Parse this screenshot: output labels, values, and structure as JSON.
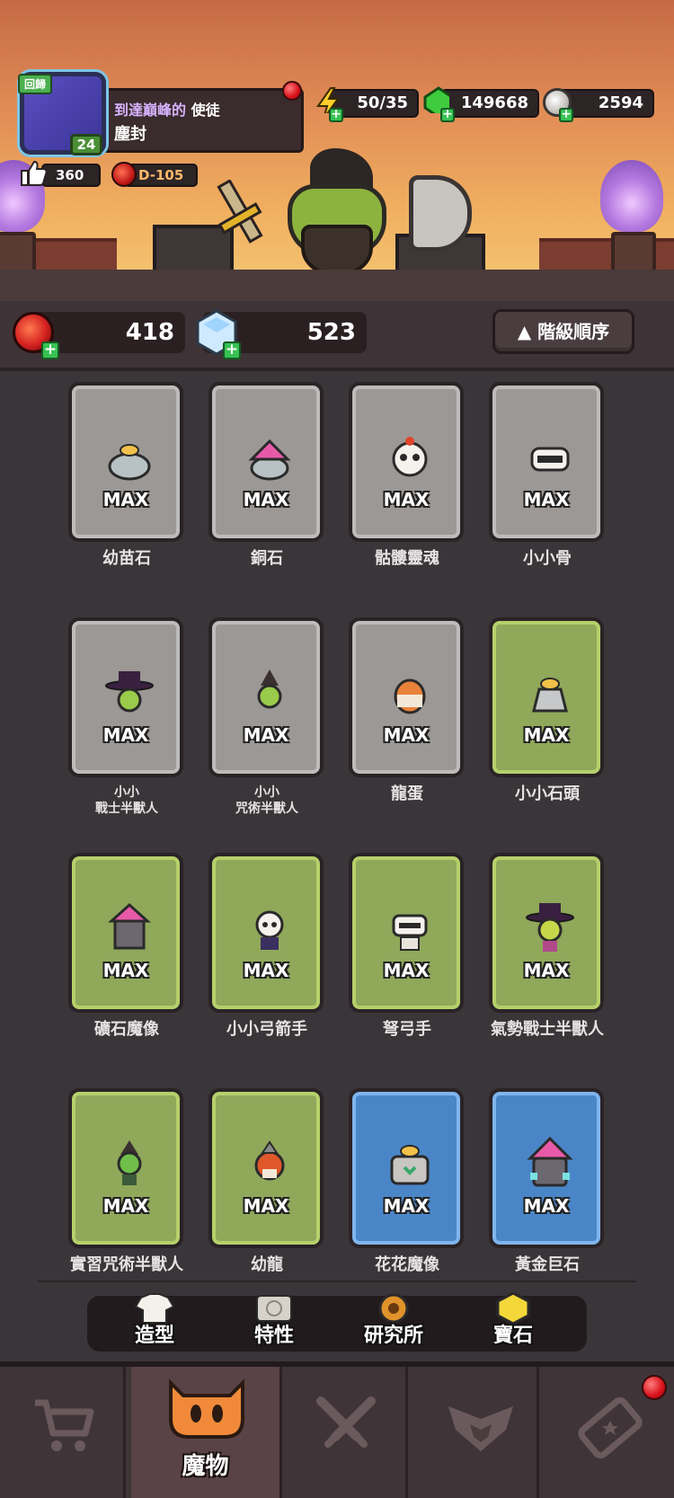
{
  "header": {
    "return_badge": "回歸",
    "level": "24",
    "title_prefix": "到達巔峰的",
    "title_suffix": "使徒",
    "player_name": "塵封",
    "likes": "360",
    "rank": "D-105"
  },
  "resources": {
    "energy": "50/35",
    "gems": "149668",
    "coins": "2594"
  },
  "currency": {
    "red_orb": "418",
    "crystal": "523"
  },
  "sort_button": {
    "icon": "▲",
    "label": "階級順序"
  },
  "monsters": [
    {
      "name": "幼苗石",
      "badge": "MAX",
      "rarity": "gray",
      "icon": "rock-sprout-icon"
    },
    {
      "name": "銅石",
      "badge": "MAX",
      "rarity": "gray",
      "icon": "copper-rock-icon"
    },
    {
      "name": "骷髏靈魂",
      "badge": "MAX",
      "rarity": "gray",
      "icon": "skull-spirit-icon"
    },
    {
      "name": "小小骨",
      "badge": "MAX",
      "rarity": "gray",
      "icon": "little-bone-icon"
    },
    {
      "name_line1": "小小",
      "name_line2": "戰士半獸人",
      "badge": "MAX",
      "rarity": "gray",
      "icon": "orc-warrior-icon"
    },
    {
      "name_line1": "小小",
      "name_line2": "咒術半獸人",
      "badge": "MAX",
      "rarity": "gray",
      "icon": "orc-shaman-icon"
    },
    {
      "name": "龍蛋",
      "badge": "MAX",
      "rarity": "gray",
      "icon": "dragon-egg-icon"
    },
    {
      "name": "小小石頭",
      "badge": "MAX",
      "rarity": "green",
      "icon": "small-stone-icon"
    },
    {
      "name": "礦石魔像",
      "badge": "MAX",
      "rarity": "green",
      "icon": "ore-golem-icon"
    },
    {
      "name": "小小弓箭手",
      "badge": "MAX",
      "rarity": "green",
      "icon": "skeleton-archer-icon"
    },
    {
      "name": "弩弓手",
      "badge": "MAX",
      "rarity": "green",
      "icon": "crossbowman-icon"
    },
    {
      "name": "氣勢戰士半獸人",
      "badge": "MAX",
      "rarity": "green",
      "icon": "orc-champion-icon"
    },
    {
      "name": "實習咒術半獸人",
      "badge": "MAX",
      "rarity": "green",
      "icon": "orc-apprentice-icon"
    },
    {
      "name": "幼龍",
      "badge": "MAX",
      "rarity": "green",
      "icon": "baby-dragon-icon"
    },
    {
      "name": "花花魔像",
      "badge": "MAX",
      "rarity": "blue",
      "icon": "flower-golem-icon"
    },
    {
      "name": "黃金巨石",
      "badge": "MAX",
      "rarity": "blue",
      "icon": "golden-boulder-icon"
    }
  ],
  "subnav": [
    {
      "label": "造型",
      "icon": "costume-icon"
    },
    {
      "label": "特性",
      "icon": "trait-scroll-icon"
    },
    {
      "label": "研究所",
      "icon": "research-gear-icon"
    },
    {
      "label": "寶石",
      "icon": "gem-icon"
    }
  ],
  "tabs": [
    {
      "label": "",
      "icon": "cart-icon"
    },
    {
      "label": "魔物",
      "icon": "monster-face-icon"
    },
    {
      "label": "",
      "icon": "crossed-swords-icon"
    },
    {
      "label": "",
      "icon": "rank-emblem-icon"
    },
    {
      "label": "",
      "icon": "ticket-icon"
    }
  ],
  "colors": {
    "card_gray": "#9b9895",
    "card_green": "#8fa85a",
    "card_blue": "#4a86c7",
    "active_tab": "#5a4347",
    "accent_orange": "#f08a3a"
  }
}
